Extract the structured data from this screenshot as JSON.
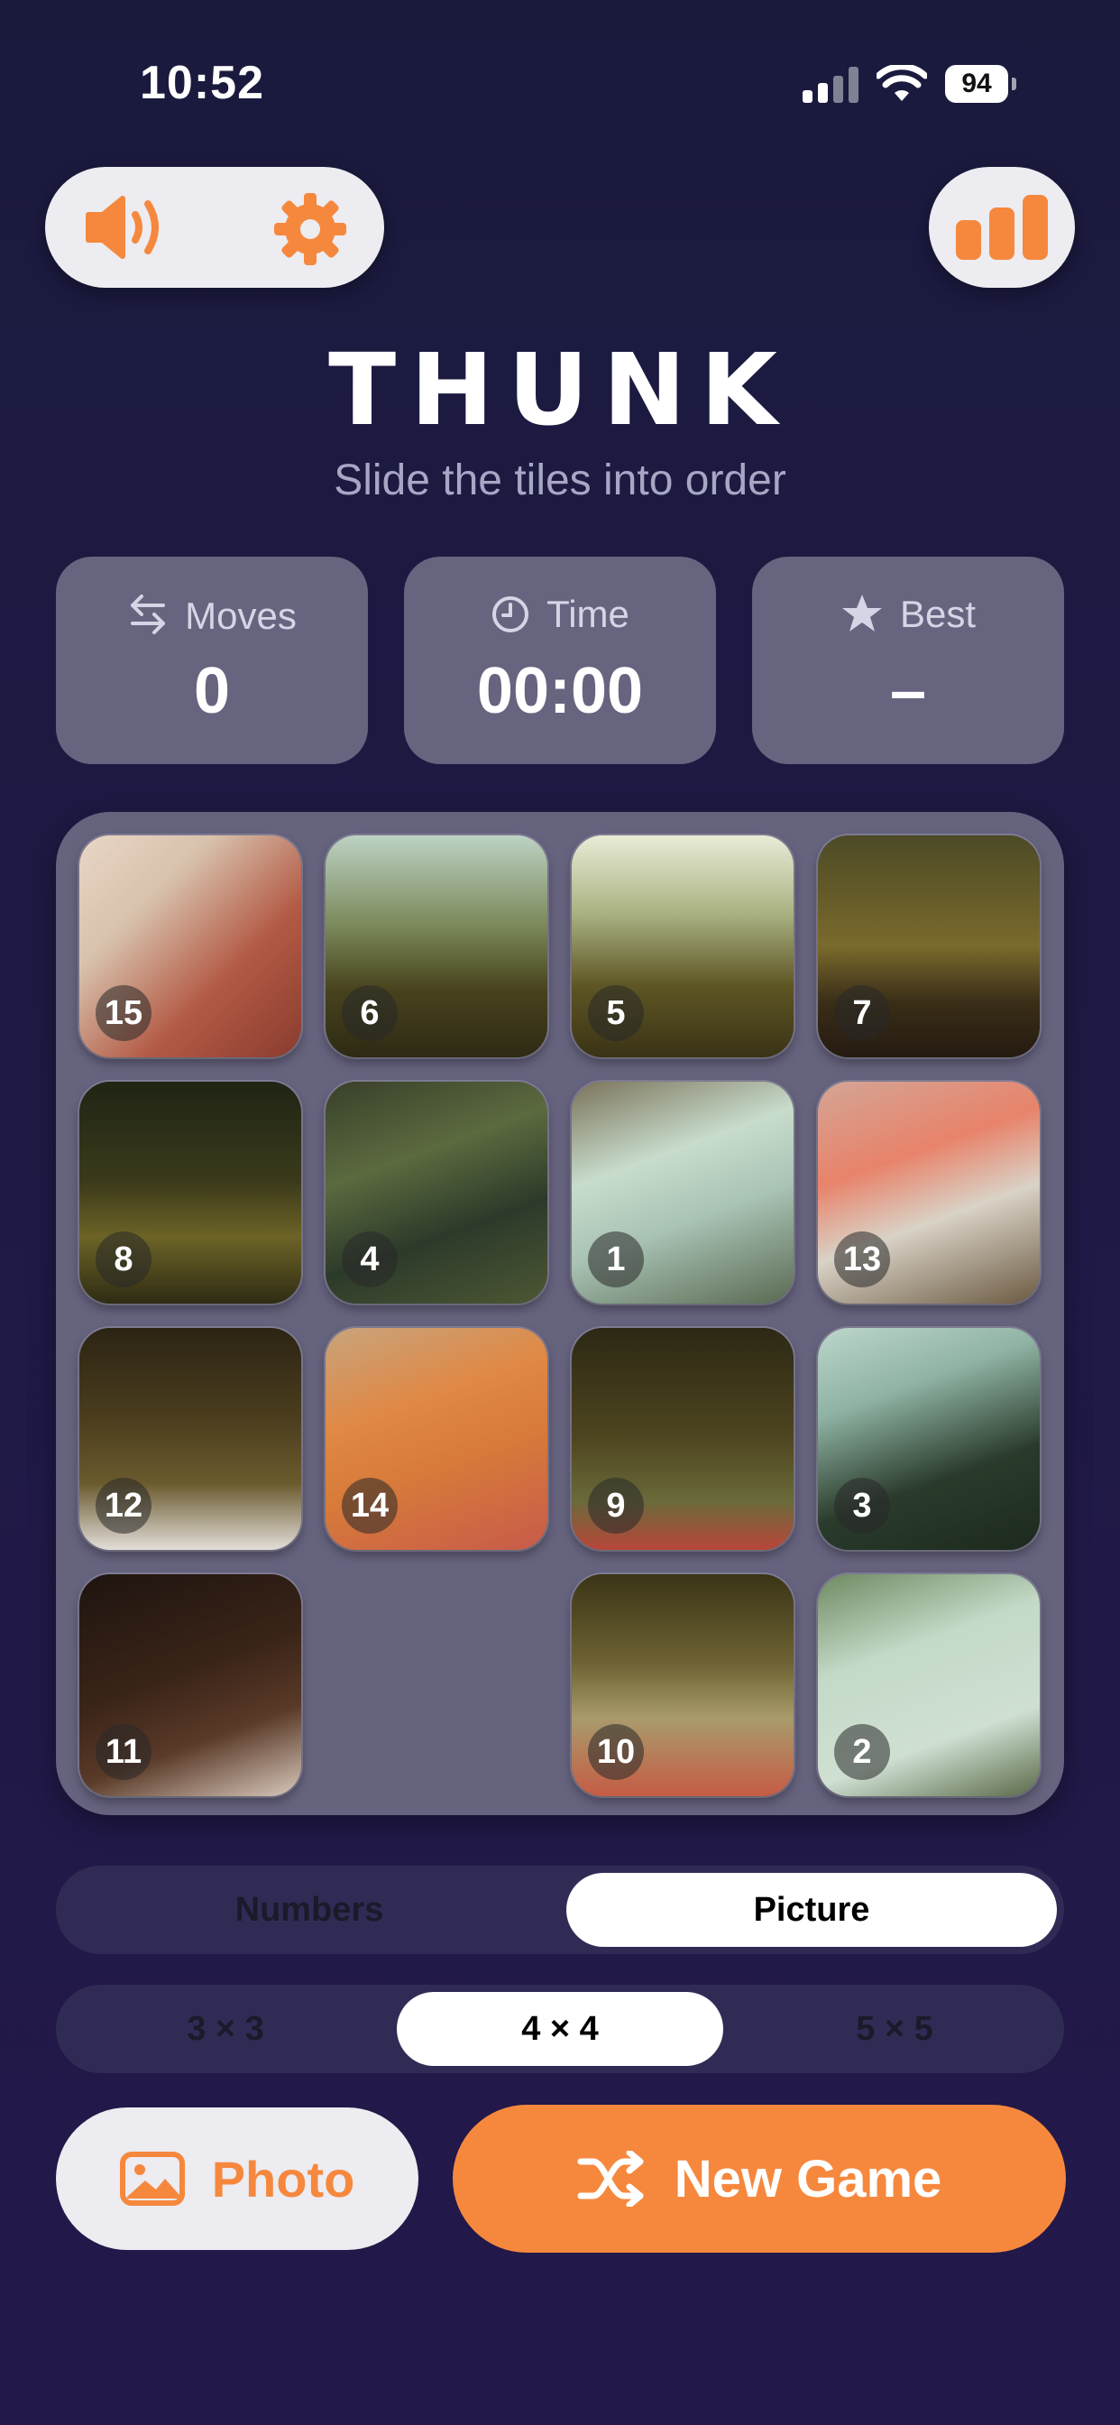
{
  "status_bar": {
    "time": "10:52",
    "battery": "94"
  },
  "app": {
    "title": "THUNK",
    "subtitle": "Slide the tiles into order"
  },
  "stats": {
    "moves": {
      "label": "Moves",
      "value": "0"
    },
    "time": {
      "label": "Time",
      "value": "00:00"
    },
    "best": {
      "label": "Best",
      "value": "–"
    }
  },
  "board": {
    "size": "4 × 4",
    "tiles": [
      [
        "15",
        "6",
        "5",
        "7"
      ],
      [
        "8",
        "4",
        "1",
        "13"
      ],
      [
        "12",
        "14",
        "9",
        "3"
      ],
      [
        "11",
        "",
        "10",
        "2"
      ]
    ]
  },
  "mode_toggle": {
    "options": [
      "Numbers",
      "Picture"
    ],
    "selected": "Picture"
  },
  "grid_size": {
    "options": [
      "3 × 3",
      "4 × 4",
      "5 × 5"
    ],
    "selected": "4 × 4"
  },
  "actions": {
    "photo": "Photo",
    "new_game": "New Game"
  },
  "colors": {
    "accent": "#f6883e",
    "background": "#1e1a45",
    "card": "#66647f"
  }
}
